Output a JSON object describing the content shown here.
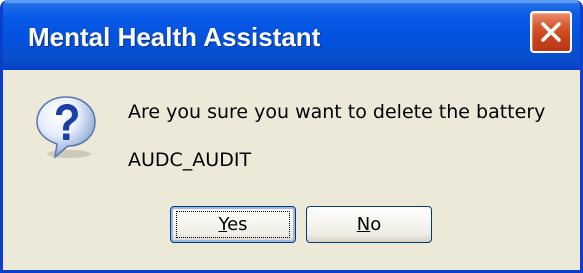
{
  "window": {
    "title": "Mental Health Assistant"
  },
  "dialog": {
    "icon": "question-icon",
    "message": "Are you sure you want to delete the battery",
    "battery_name": "AUDC_AUDIT"
  },
  "buttons": {
    "yes": {
      "mnemonic": "Y",
      "rest": "es"
    },
    "no": {
      "mnemonic": "N",
      "rest": "o"
    }
  },
  "colors": {
    "titlebar": "#0553E1",
    "dialog_background": "#ECE9D8",
    "close_button": "#D7592E"
  }
}
